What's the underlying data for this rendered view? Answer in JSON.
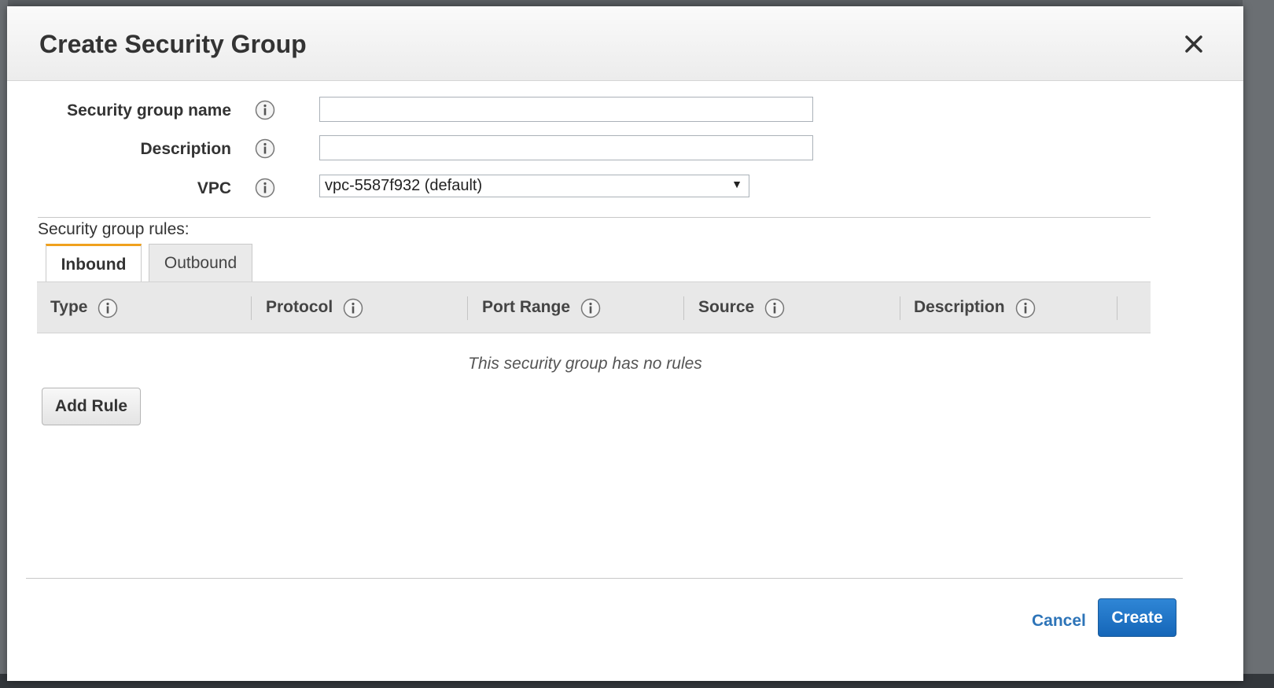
{
  "dialog": {
    "title": "Create Security Group",
    "close_icon": "close-icon"
  },
  "form": {
    "name_label": "Security group name",
    "name_value": "",
    "description_label": "Description",
    "description_value": "",
    "vpc_label": "VPC",
    "vpc_selected": "vpc-5587f932 (default)"
  },
  "rules": {
    "section_label": "Security group rules:",
    "tabs": [
      {
        "label": "Inbound",
        "active": true
      },
      {
        "label": "Outbound",
        "active": false
      }
    ],
    "columns": [
      "Type",
      "Protocol",
      "Port Range",
      "Source",
      "Description"
    ],
    "empty_message": "This security group has no rules",
    "add_rule_label": "Add Rule"
  },
  "footer": {
    "cancel_label": "Cancel",
    "create_label": "Create"
  },
  "colors": {
    "accent_tab": "#f0a11e",
    "primary_button": "#1f77c8",
    "link": "#2d74b8"
  }
}
